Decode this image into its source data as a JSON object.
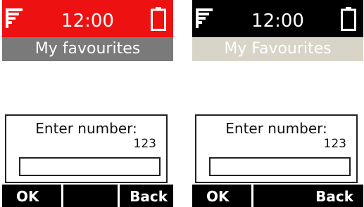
{
  "screens": [
    {
      "status": {
        "time": "12:00",
        "signal_icon": "signal-strength-icon",
        "battery_icon": "battery-icon"
      },
      "title": "My favourites",
      "dialog": {
        "label": "Enter number:",
        "value": "123",
        "input_value": ""
      },
      "softkeys": {
        "left": "OK",
        "middle": "",
        "right": "Back"
      },
      "colors": {
        "status_bar": "#ee1111",
        "title_bar": "#7a7a7a"
      }
    },
    {
      "status": {
        "time": "12:00",
        "signal_icon": "signal-strength-icon",
        "battery_icon": "battery-icon"
      },
      "title": "My Favourites",
      "dialog": {
        "label": "Enter number:",
        "value": "123",
        "input_value": ""
      },
      "softkeys": {
        "left": "OK",
        "right": "Back"
      },
      "colors": {
        "status_bar": "#000000",
        "title_bar": "#d8d4c8"
      }
    }
  ]
}
